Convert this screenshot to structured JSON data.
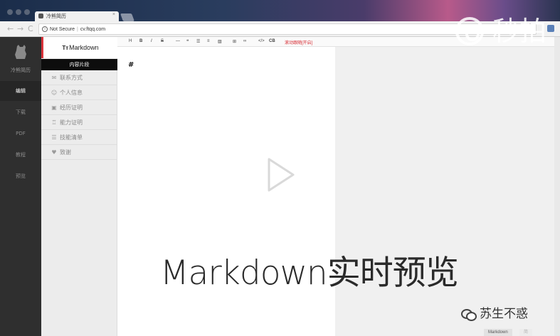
{
  "browser": {
    "tab_title": "冷熊简历",
    "tab_close": "×",
    "back": "←",
    "forward": "→",
    "reload": "C",
    "security_label": "Not Secure",
    "url": "cv.ftqq.com"
  },
  "sidebar": {
    "logo_text": "冷熊简历",
    "items": [
      {
        "label": "编辑",
        "active": true
      },
      {
        "label": "下载",
        "active": false
      },
      {
        "label": "PDF",
        "active": false
      },
      {
        "label": "教程",
        "active": false
      },
      {
        "label": "预览",
        "active": false
      }
    ]
  },
  "snippets": {
    "title_prefix": "Tт",
    "title": "Markdown",
    "section_header": "内容片段",
    "items": [
      {
        "label": "联系方式",
        "icon": "envelope-icon",
        "glyph": "✉"
      },
      {
        "label": "个人信息",
        "icon": "smile-icon",
        "glyph": "☺"
      },
      {
        "label": "经历证明",
        "icon": "briefcase-icon",
        "glyph": "▣"
      },
      {
        "label": "能力证明",
        "icon": "trophy-icon",
        "glyph": "♖"
      },
      {
        "label": "技能清单",
        "icon": "list-icon",
        "glyph": "☰"
      },
      {
        "label": "致谢",
        "icon": "thumbs-up-icon",
        "glyph": "♥"
      }
    ]
  },
  "toolbar": {
    "heading": "H",
    "bold": "B",
    "italic": "I",
    "strike": "S",
    "hr": "—",
    "quote": "❝",
    "ul": "☰",
    "ol": "≡",
    "image": "▨",
    "table": "⊞",
    "link": "∞",
    "code": "</>",
    "codeblock": "CB",
    "scroll_sync": "滚动跟随[开启]"
  },
  "editor": {
    "content": "#"
  },
  "bottom_tabs": {
    "markdown": "Markdown",
    "other": "简历新模板"
  },
  "overlay": {
    "caption": "Markdown实时预览",
    "watermark_top": "秒拍",
    "watermark_bottom": "苏生不惑"
  }
}
